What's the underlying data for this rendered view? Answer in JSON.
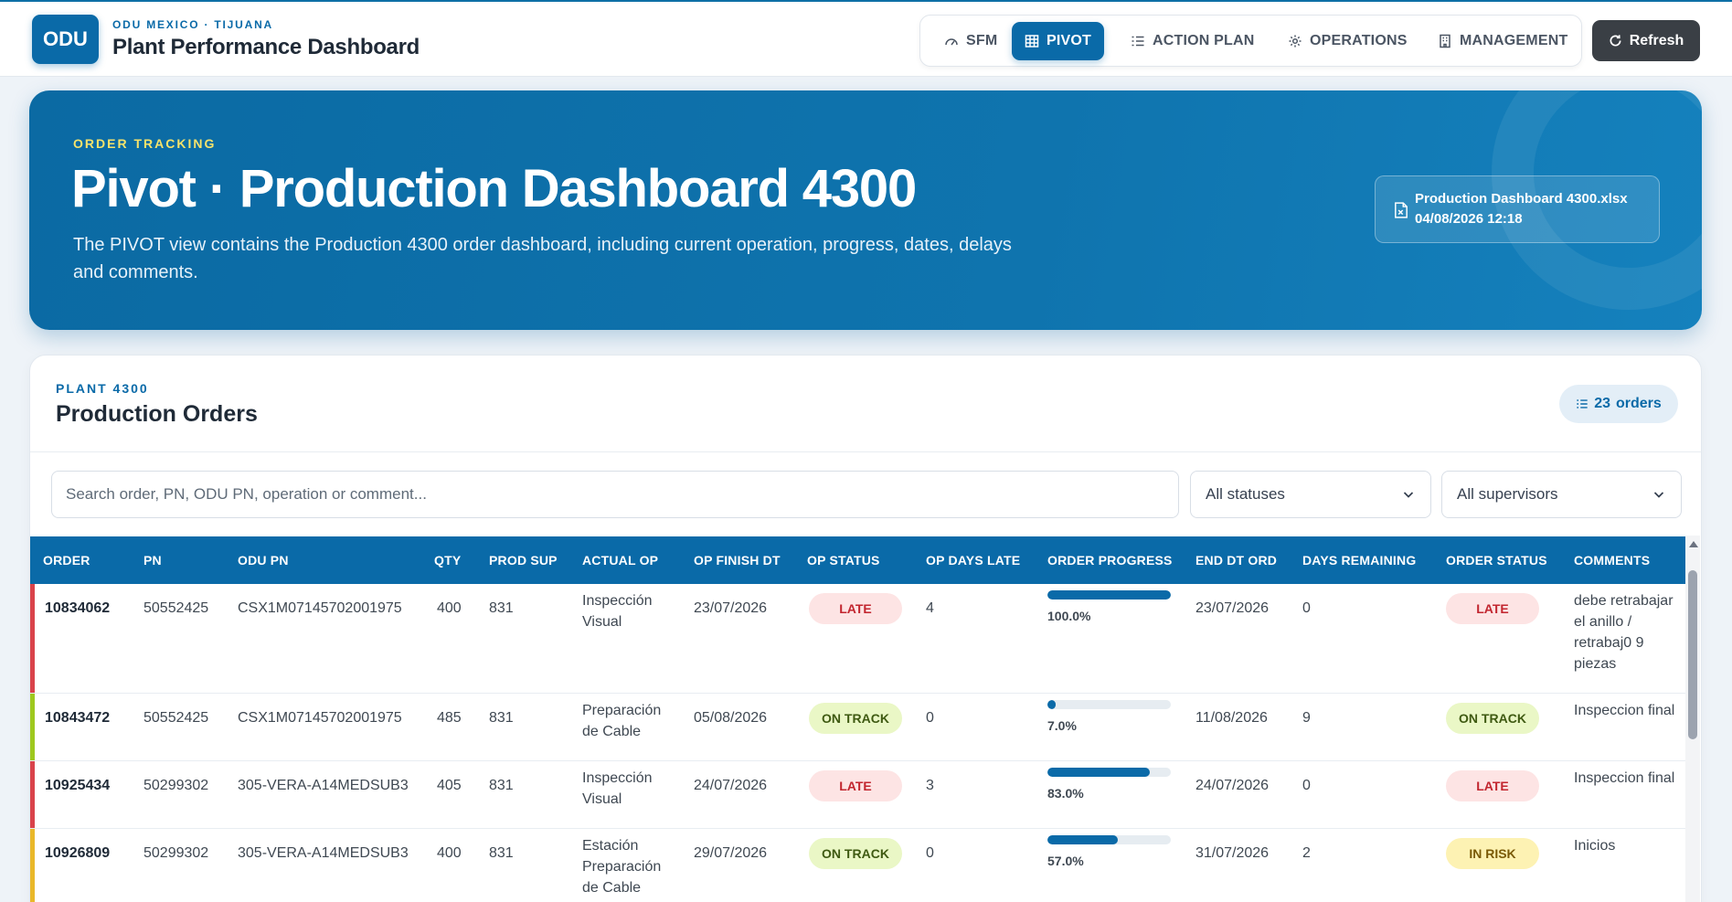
{
  "header": {
    "logo": "ODU",
    "subtitle": "ODU MEXICO · TIJUANA",
    "title": "Plant Performance Dashboard",
    "nav": [
      {
        "label": "SFM",
        "icon": "gauge-icon",
        "active": false
      },
      {
        "label": "PIVOT",
        "icon": "table-icon",
        "active": true
      },
      {
        "label": "ACTION PLAN",
        "icon": "list-icon",
        "active": false
      },
      {
        "label": "OPERATIONS",
        "icon": "gear-icon",
        "active": false
      },
      {
        "label": "MANAGEMENT",
        "icon": "building-icon",
        "active": false
      }
    ],
    "refresh_label": "Refresh"
  },
  "hero": {
    "eyebrow": "ORDER TRACKING",
    "title": "Pivot · Production Dashboard 4300",
    "description": "The PIVOT view contains the Production 4300 order dashboard, including current operation, progress, dates, delays and comments.",
    "file_name": "Production Dashboard 4300.xlsx",
    "file_date": "04/08/2026 12:18"
  },
  "orders_card": {
    "eyebrow": "PLANT 4300",
    "title": "Production Orders",
    "count": "23",
    "count_label": "orders",
    "search_placeholder": "Search order, PN, ODU PN, operation or comment...",
    "status_filter": "All statuses",
    "supervisor_filter": "All supervisors"
  },
  "table": {
    "columns": [
      "ORDER",
      "PN",
      "ODU PN",
      "QTY",
      "PROD SUP",
      "ACTUAL OP",
      "OP FINISH DT",
      "OP STATUS",
      "OP DAYS LATE",
      "ORDER PROGRESS",
      "END DT ORD",
      "DAYS REMAINING",
      "ORDER STATUS",
      "COMMENTS"
    ],
    "rows": [
      {
        "order": "10834062",
        "pn": "50552425",
        "odu_pn": "CSX1M07145702001975",
        "qty": "400",
        "prod_sup": "831",
        "actual_op": "Inspección Visual",
        "op_finish": "23/07/2026",
        "op_status": "LATE",
        "days_late": "4",
        "progress": 100,
        "progress_label": "100.0%",
        "end_dt": "23/07/2026",
        "days_remaining": "0",
        "order_status": "LATE",
        "comments": "debe retrabajar el anillo / retrabaj0 9 piezas",
        "accent": "#d9434b"
      },
      {
        "order": "10843472",
        "pn": "50552425",
        "odu_pn": "CSX1M07145702001975",
        "qty": "485",
        "prod_sup": "831",
        "actual_op": "Preparación de Cable",
        "op_finish": "05/08/2026",
        "op_status": "ON TRACK",
        "days_late": "0",
        "progress": 7,
        "progress_label": "7.0%",
        "end_dt": "11/08/2026",
        "days_remaining": "9",
        "order_status": "ON TRACK",
        "comments": "Inspeccion final",
        "accent": "#9ec81e"
      },
      {
        "order": "10925434",
        "pn": "50299302",
        "odu_pn": "305-VERA-A14MEDSUB3",
        "qty": "405",
        "prod_sup": "831",
        "actual_op": "Inspección Visual",
        "op_finish": "24/07/2026",
        "op_status": "LATE",
        "days_late": "3",
        "progress": 83,
        "progress_label": "83.0%",
        "end_dt": "24/07/2026",
        "days_remaining": "0",
        "order_status": "LATE",
        "comments": "Inspeccion final",
        "accent": "#d9434b"
      },
      {
        "order": "10926809",
        "pn": "50299302",
        "odu_pn": "305-VERA-A14MEDSUB3",
        "qty": "400",
        "prod_sup": "831",
        "actual_op": "Estación Preparación de Cable inicial",
        "op_finish": "29/07/2026",
        "op_status": "ON TRACK",
        "days_late": "0",
        "progress": 57,
        "progress_label": "57.0%",
        "end_dt": "31/07/2026",
        "days_remaining": "2",
        "order_status": "IN RISK",
        "comments": "Inicios",
        "accent": "#e9b82a"
      }
    ]
  }
}
